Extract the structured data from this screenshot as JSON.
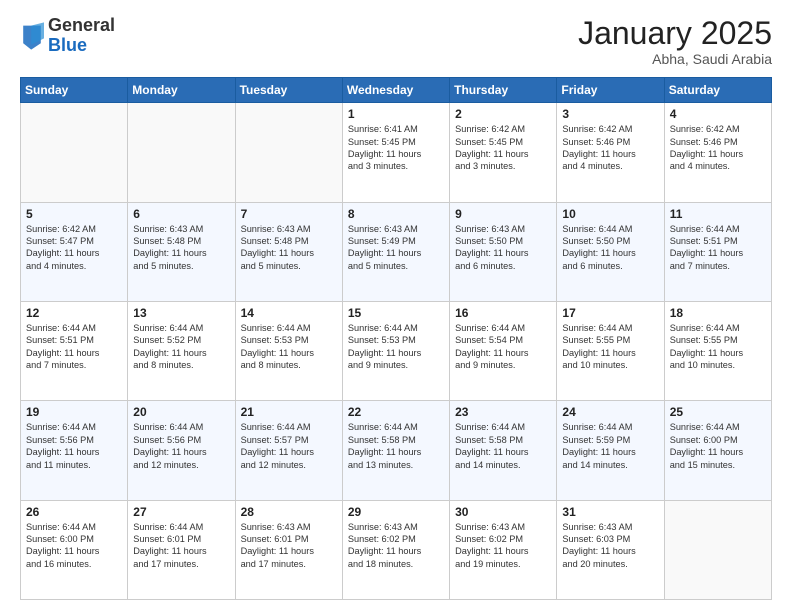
{
  "header": {
    "logo_general": "General",
    "logo_blue": "Blue",
    "month_title": "January 2025",
    "subtitle": "Abha, Saudi Arabia"
  },
  "days_of_week": [
    "Sunday",
    "Monday",
    "Tuesday",
    "Wednesday",
    "Thursday",
    "Friday",
    "Saturday"
  ],
  "weeks": [
    [
      {
        "day": "",
        "lines": []
      },
      {
        "day": "",
        "lines": []
      },
      {
        "day": "",
        "lines": []
      },
      {
        "day": "1",
        "lines": [
          "Sunrise: 6:41 AM",
          "Sunset: 5:45 PM",
          "Daylight: 11 hours",
          "and 3 minutes."
        ]
      },
      {
        "day": "2",
        "lines": [
          "Sunrise: 6:42 AM",
          "Sunset: 5:45 PM",
          "Daylight: 11 hours",
          "and 3 minutes."
        ]
      },
      {
        "day": "3",
        "lines": [
          "Sunrise: 6:42 AM",
          "Sunset: 5:46 PM",
          "Daylight: 11 hours",
          "and 4 minutes."
        ]
      },
      {
        "day": "4",
        "lines": [
          "Sunrise: 6:42 AM",
          "Sunset: 5:46 PM",
          "Daylight: 11 hours",
          "and 4 minutes."
        ]
      }
    ],
    [
      {
        "day": "5",
        "lines": [
          "Sunrise: 6:42 AM",
          "Sunset: 5:47 PM",
          "Daylight: 11 hours",
          "and 4 minutes."
        ]
      },
      {
        "day": "6",
        "lines": [
          "Sunrise: 6:43 AM",
          "Sunset: 5:48 PM",
          "Daylight: 11 hours",
          "and 5 minutes."
        ]
      },
      {
        "day": "7",
        "lines": [
          "Sunrise: 6:43 AM",
          "Sunset: 5:48 PM",
          "Daylight: 11 hours",
          "and 5 minutes."
        ]
      },
      {
        "day": "8",
        "lines": [
          "Sunrise: 6:43 AM",
          "Sunset: 5:49 PM",
          "Daylight: 11 hours",
          "and 5 minutes."
        ]
      },
      {
        "day": "9",
        "lines": [
          "Sunrise: 6:43 AM",
          "Sunset: 5:50 PM",
          "Daylight: 11 hours",
          "and 6 minutes."
        ]
      },
      {
        "day": "10",
        "lines": [
          "Sunrise: 6:44 AM",
          "Sunset: 5:50 PM",
          "Daylight: 11 hours",
          "and 6 minutes."
        ]
      },
      {
        "day": "11",
        "lines": [
          "Sunrise: 6:44 AM",
          "Sunset: 5:51 PM",
          "Daylight: 11 hours",
          "and 7 minutes."
        ]
      }
    ],
    [
      {
        "day": "12",
        "lines": [
          "Sunrise: 6:44 AM",
          "Sunset: 5:51 PM",
          "Daylight: 11 hours",
          "and 7 minutes."
        ]
      },
      {
        "day": "13",
        "lines": [
          "Sunrise: 6:44 AM",
          "Sunset: 5:52 PM",
          "Daylight: 11 hours",
          "and 8 minutes."
        ]
      },
      {
        "day": "14",
        "lines": [
          "Sunrise: 6:44 AM",
          "Sunset: 5:53 PM",
          "Daylight: 11 hours",
          "and 8 minutes."
        ]
      },
      {
        "day": "15",
        "lines": [
          "Sunrise: 6:44 AM",
          "Sunset: 5:53 PM",
          "Daylight: 11 hours",
          "and 9 minutes."
        ]
      },
      {
        "day": "16",
        "lines": [
          "Sunrise: 6:44 AM",
          "Sunset: 5:54 PM",
          "Daylight: 11 hours",
          "and 9 minutes."
        ]
      },
      {
        "day": "17",
        "lines": [
          "Sunrise: 6:44 AM",
          "Sunset: 5:55 PM",
          "Daylight: 11 hours",
          "and 10 minutes."
        ]
      },
      {
        "day": "18",
        "lines": [
          "Sunrise: 6:44 AM",
          "Sunset: 5:55 PM",
          "Daylight: 11 hours",
          "and 10 minutes."
        ]
      }
    ],
    [
      {
        "day": "19",
        "lines": [
          "Sunrise: 6:44 AM",
          "Sunset: 5:56 PM",
          "Daylight: 11 hours",
          "and 11 minutes."
        ]
      },
      {
        "day": "20",
        "lines": [
          "Sunrise: 6:44 AM",
          "Sunset: 5:56 PM",
          "Daylight: 11 hours",
          "and 12 minutes."
        ]
      },
      {
        "day": "21",
        "lines": [
          "Sunrise: 6:44 AM",
          "Sunset: 5:57 PM",
          "Daylight: 11 hours",
          "and 12 minutes."
        ]
      },
      {
        "day": "22",
        "lines": [
          "Sunrise: 6:44 AM",
          "Sunset: 5:58 PM",
          "Daylight: 11 hours",
          "and 13 minutes."
        ]
      },
      {
        "day": "23",
        "lines": [
          "Sunrise: 6:44 AM",
          "Sunset: 5:58 PM",
          "Daylight: 11 hours",
          "and 14 minutes."
        ]
      },
      {
        "day": "24",
        "lines": [
          "Sunrise: 6:44 AM",
          "Sunset: 5:59 PM",
          "Daylight: 11 hours",
          "and 14 minutes."
        ]
      },
      {
        "day": "25",
        "lines": [
          "Sunrise: 6:44 AM",
          "Sunset: 6:00 PM",
          "Daylight: 11 hours",
          "and 15 minutes."
        ]
      }
    ],
    [
      {
        "day": "26",
        "lines": [
          "Sunrise: 6:44 AM",
          "Sunset: 6:00 PM",
          "Daylight: 11 hours",
          "and 16 minutes."
        ]
      },
      {
        "day": "27",
        "lines": [
          "Sunrise: 6:44 AM",
          "Sunset: 6:01 PM",
          "Daylight: 11 hours",
          "and 17 minutes."
        ]
      },
      {
        "day": "28",
        "lines": [
          "Sunrise: 6:43 AM",
          "Sunset: 6:01 PM",
          "Daylight: 11 hours",
          "and 17 minutes."
        ]
      },
      {
        "day": "29",
        "lines": [
          "Sunrise: 6:43 AM",
          "Sunset: 6:02 PM",
          "Daylight: 11 hours",
          "and 18 minutes."
        ]
      },
      {
        "day": "30",
        "lines": [
          "Sunrise: 6:43 AM",
          "Sunset: 6:02 PM",
          "Daylight: 11 hours",
          "and 19 minutes."
        ]
      },
      {
        "day": "31",
        "lines": [
          "Sunrise: 6:43 AM",
          "Sunset: 6:03 PM",
          "Daylight: 11 hours",
          "and 20 minutes."
        ]
      },
      {
        "day": "",
        "lines": []
      }
    ]
  ]
}
